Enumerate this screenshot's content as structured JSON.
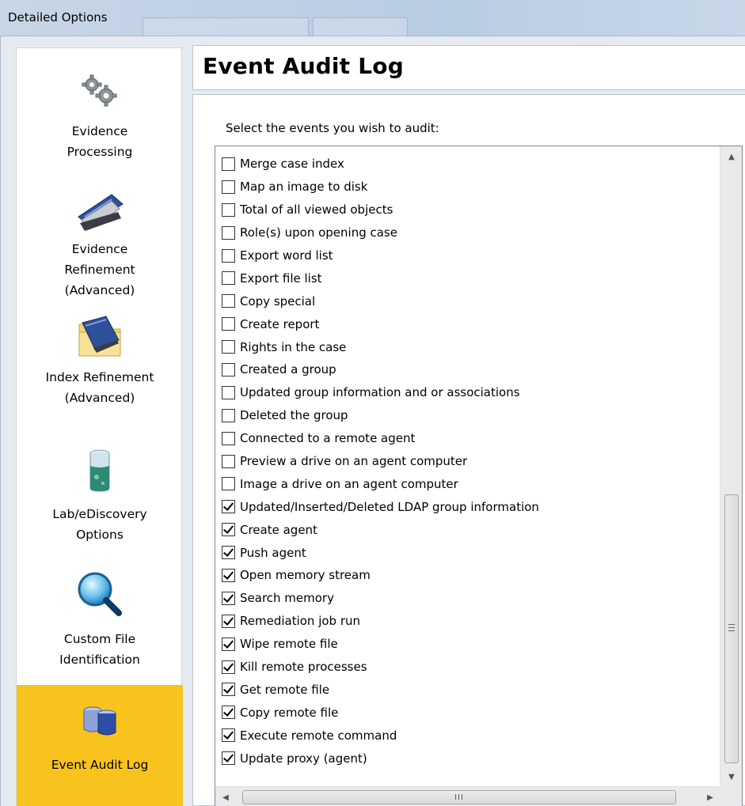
{
  "window": {
    "title": "Detailed Options"
  },
  "sidebar": {
    "items": [
      {
        "label_line1": "Evidence",
        "label_line2": "Processing",
        "label_line3": "",
        "icon": "gears-icon",
        "active": false
      },
      {
        "label_line1": "Evidence",
        "label_line2": "Refinement",
        "label_line3": "(Advanced)",
        "icon": "stapler-icon",
        "active": false
      },
      {
        "label_line1": "Index Refinement",
        "label_line2": "(Advanced)",
        "label_line3": "",
        "icon": "folder-stapler-icon",
        "active": false
      },
      {
        "label_line1": "Lab/eDiscovery",
        "label_line2": "Options",
        "label_line3": "",
        "icon": "beaker-icon",
        "active": false
      },
      {
        "label_line1": "Custom File",
        "label_line2": "Identification",
        "label_line3": "",
        "icon": "magnifier-icon",
        "active": false
      },
      {
        "label_line1": "Event Audit Log",
        "label_line2": "",
        "label_line3": "",
        "icon": "database-icon",
        "active": true
      }
    ],
    "active_color": "#f8c31c"
  },
  "main": {
    "heading": "Event Audit Log",
    "prompt": "Select the events you wish to audit:",
    "events": [
      {
        "label": "Merge case index",
        "checked": false
      },
      {
        "label": "Map an image to disk",
        "checked": false
      },
      {
        "label": "Total of all viewed objects",
        "checked": false
      },
      {
        "label": "Role(s) upon opening case",
        "checked": false
      },
      {
        "label": "Export word list",
        "checked": false
      },
      {
        "label": "Export file list",
        "checked": false
      },
      {
        "label": "Copy special",
        "checked": false
      },
      {
        "label": "Create report",
        "checked": false
      },
      {
        "label": "Rights in the case",
        "checked": false
      },
      {
        "label": "Created a group",
        "checked": false
      },
      {
        "label": "Updated group information and or associations",
        "checked": false
      },
      {
        "label": "Deleted the group",
        "checked": false
      },
      {
        "label": "Connected to a remote agent",
        "checked": false
      },
      {
        "label": "Preview a drive on an agent computer",
        "checked": false
      },
      {
        "label": "Image a drive on an agent computer",
        "checked": false
      },
      {
        "label": "Updated/Inserted/Deleted LDAP group information",
        "checked": true
      },
      {
        "label": "Create agent",
        "checked": true
      },
      {
        "label": "Push agent",
        "checked": true
      },
      {
        "label": "Open memory stream",
        "checked": true
      },
      {
        "label": "Search memory",
        "checked": true
      },
      {
        "label": "Remediation job run",
        "checked": true
      },
      {
        "label": "Wipe remote file",
        "checked": true
      },
      {
        "label": "Kill remote processes",
        "checked": true
      },
      {
        "label": "Get remote file",
        "checked": true
      },
      {
        "label": "Copy remote file",
        "checked": true
      },
      {
        "label": "Execute remote command",
        "checked": true
      },
      {
        "label": "Update proxy (agent)",
        "checked": true
      }
    ],
    "hscroll_thumb_label": "III"
  }
}
